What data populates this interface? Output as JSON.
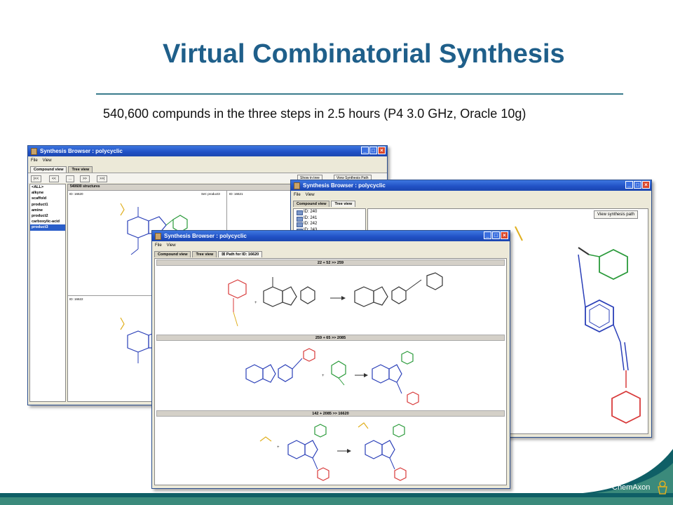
{
  "slide": {
    "title": "Virtual Combinatorial Synthesis",
    "subtitle": "540,600 compunds in the three steps in 2.5 hours (P4 3.0 GHz, Oracle 10g)",
    "brand": "ChemAxon"
  },
  "window_back": {
    "title": "Synthesis Browser : polycyclic",
    "menu": [
      "File",
      "View"
    ],
    "tabs": [
      "Compound view",
      "Tree view"
    ],
    "nav_buttons": [
      "|<<",
      "<<",
      "...",
      ">>",
      ">>|"
    ],
    "show_in_tree_label": "Show in tree",
    "view_synthesis_path_label": "View Synthesis Path",
    "structures_count": "540600 structures",
    "list_items": [
      "<ALL>",
      "alkyne",
      "scaffold",
      "product1",
      "amine",
      "product2",
      "carboxylic-acid",
      "product3"
    ],
    "selected_item": "product3",
    "cells": [
      {
        "id": "ID: 16620",
        "set": "Set: product3"
      },
      {
        "id": "ID: 16621"
      },
      {
        "id": "ID: 16622"
      }
    ]
  },
  "window_right": {
    "title": "Synthesis Browser : polycyclic",
    "menu": [
      "File",
      "View"
    ],
    "tabs": [
      "Compound view",
      "Tree view"
    ],
    "view_synthesis_path_label": "View synthesis path",
    "tree_items": [
      "ID: 240",
      "ID: 241",
      "ID: 242",
      "ID: 243"
    ]
  },
  "window_front": {
    "title": "Synthesis Browser : polycyclic",
    "menu": [
      "File",
      "View"
    ],
    "tabs": [
      "Compound view",
      "Tree view"
    ],
    "path_tab_label": "Path for ID: 16620",
    "steps": [
      "22 + 52  >>  259",
      "259 + 65  >>  2085",
      "142 + 2085  >>  16620"
    ]
  },
  "colors": {
    "title_blue": "#1f5f8a",
    "xp_titlebar": "#2050c4",
    "footer_dark": "#0f5f66",
    "footer_light": "#3b8a7b",
    "mol_red": "#d83a3a",
    "mol_blue": "#2a3fb8",
    "mol_green": "#2a9a3a",
    "mol_orange": "#e0b020"
  }
}
